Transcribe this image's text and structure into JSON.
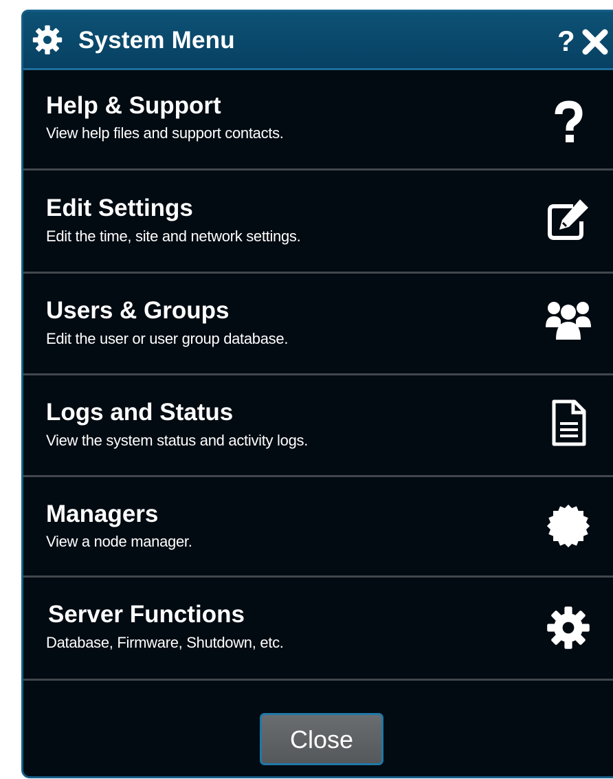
{
  "dialog": {
    "title": "System Menu",
    "help_glyph": "?",
    "icons": {
      "title": "gear-icon",
      "help": "question-icon",
      "close": "close-x-icon"
    }
  },
  "menu": {
    "items": [
      {
        "title": "Help & Support",
        "description": "View help files and support contacts.",
        "icon": "question-icon"
      },
      {
        "title": "Edit Settings",
        "description": "Edit the time, site and network settings.",
        "icon": "edit-icon"
      },
      {
        "title": "Users & Groups",
        "description": "Edit the user or user group database.",
        "icon": "users-icon"
      },
      {
        "title": "Logs and Status",
        "description": "View the system status and activity logs.",
        "icon": "document-icon"
      },
      {
        "title": "Managers",
        "description": "View a node manager.",
        "icon": "badge-icon"
      },
      {
        "title": "Server Functions",
        "description": "Database, Firmware, Shutdown, etc.",
        "icon": "gear-icon"
      }
    ]
  },
  "footer": {
    "close_label": "Close"
  },
  "colors": {
    "background": "#030b12",
    "titlebar": "#0d5275",
    "border_accent": "#1f78a6",
    "divider": "#41474d",
    "button": "#5f6265",
    "text": "#ffffff"
  }
}
